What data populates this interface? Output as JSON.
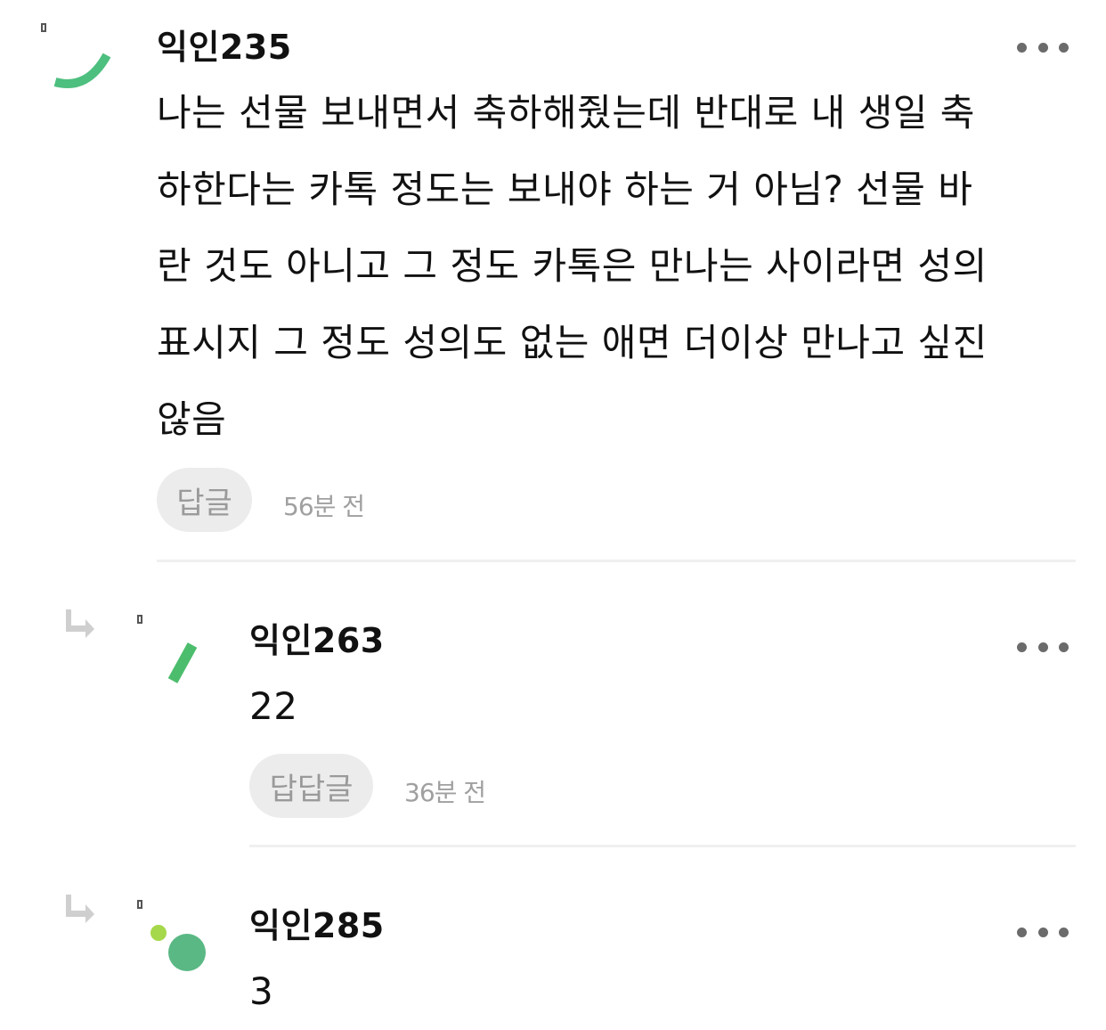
{
  "comments": [
    {
      "nickname": "익인235",
      "lines": [
        "나는 선물 보내면서 축하해줬는데 반대로 내 생일 축",
        "하한다는 카톡 정도는 보내야 하는 거 아님? 선물 바",
        "란 것도 아니고 그 정도 카톡은 만나는 사이라면 성의",
        "표시지 그 정도 성의도 없는 애면 더이상 만나고 싶진",
        "않음"
      ],
      "reply_label": "답글",
      "time": "56분 전",
      "more_icon": "more-horizontal-icon",
      "avatar_color": "#4dbf7f"
    },
    {
      "nickname": "익인263",
      "lines": [
        "22"
      ],
      "reply_label": "답답글",
      "time": "36분 전",
      "more_icon": "more-horizontal-icon",
      "avatar_color": "#4cbd6c",
      "reply_icon": "reply-arrow-icon"
    },
    {
      "nickname": "익인285",
      "lines": [
        "3"
      ],
      "more_icon": "more-horizontal-icon",
      "avatar_color": "#5ab884",
      "avatar_accent": "#a5d84a",
      "reply_icon": "reply-arrow-icon"
    }
  ]
}
